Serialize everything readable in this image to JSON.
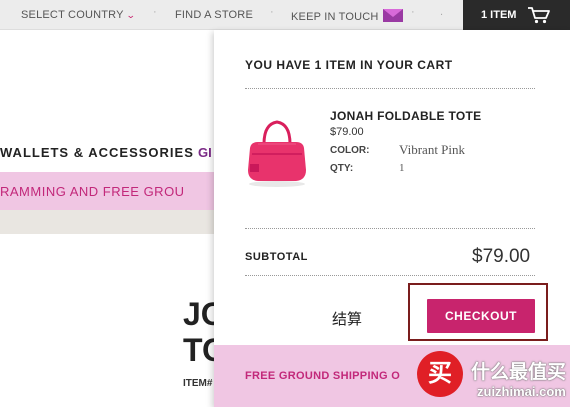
{
  "topbar": {
    "select_country": "SELECT COUNTRY",
    "find_store": "FIND A STORE",
    "keep_in_touch": "KEEP IN TOUCH",
    "cart_count": "1 ITEM",
    "dot": "·",
    "dot_trailing": "."
  },
  "page": {
    "nav_text": "WALLETS & ACCESSORIES",
    "nav_text2": "GI",
    "banner_text": "RAMMING AND FREE GROU",
    "product_title_line1": "JO",
    "product_title_line2": "TO",
    "item_number_label": "ITEM#"
  },
  "cart": {
    "heading": "YOU HAVE 1 ITEM IN YOUR CART",
    "product": {
      "name": "JONAH FOLDABLE TOTE",
      "price": "$79.00",
      "color_label": "COLOR:",
      "color_value": "Vibrant Pink",
      "qty_label": "QTY:",
      "qty_value": "1"
    },
    "subtotal_label": "SUBTOTAL",
    "subtotal_value": "$79.00",
    "annotation": "结算",
    "checkout_label": "CHECKOUT",
    "shipping_text": "FREE GROUND SHIPPING O"
  },
  "watermark": {
    "logo_char": "买",
    "zh_text": "什么最值买",
    "en_text": "zuizhimai.com"
  },
  "colors": {
    "accent": "#c8246d",
    "banner_pink": "#f0c6e3",
    "dark": "#2a2a2a"
  }
}
